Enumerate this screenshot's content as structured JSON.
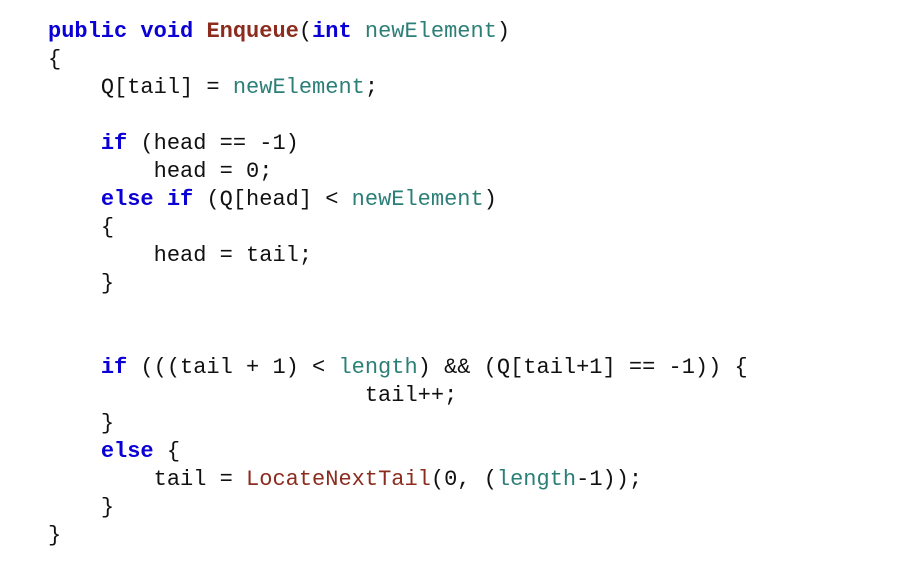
{
  "code": {
    "language": "csharp",
    "method_name": "Enqueue",
    "tokens": {
      "kw_public": "public",
      "kw_void": "void",
      "method": "Enqueue",
      "kw_int": "int",
      "param": "newElement",
      "lbrace1": "{",
      "l1_a": "Q[tail] = ",
      "l1_b": "newElement",
      "l1_c": ";",
      "kw_if1": "if",
      "cond1": " (head == -1)",
      "l3": "head = 0;",
      "kw_else1": "else",
      "kw_if2": "if",
      "cond2a": " (Q[head] < ",
      "cond2b": "newElement",
      "cond2c": ")",
      "lbrace2": "{",
      "l5": "head = tail;",
      "rbrace2": "}",
      "kw_if3": "if",
      "cond3a": " (((tail + 1) < ",
      "len1": "length",
      "cond3b": ") && (Q[tail+1] == -1)) {",
      "l8": "tail++;",
      "rbrace3": "}",
      "kw_else2": "else",
      "else_open": " {",
      "l10a": "tail = ",
      "call": "LocateNextTail",
      "l10b": "(0, (",
      "len2": "length",
      "l10c": "-1));",
      "rbrace4": "}",
      "rbrace5": "}"
    }
  }
}
